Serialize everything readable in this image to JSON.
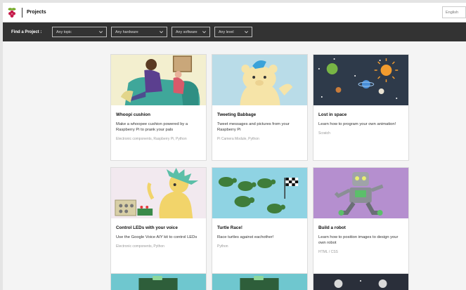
{
  "header": {
    "title": "Projects",
    "language": "English"
  },
  "filters": {
    "label": "Find a Project :",
    "topic": "Any topic",
    "hardware": "Any hardware",
    "software": "Any software",
    "level": "Any level"
  },
  "cards": [
    {
      "title": "Whoopi cushion",
      "description": "Make a whoopee cushion powered by a Raspberry Pi to prank your pals",
      "tags": "Electronic components, Raspberry Pi, Python"
    },
    {
      "title": "Tweeting Babbage",
      "description": "Tweet messages and pictures from your Raspberry Pi",
      "tags": "Pi Camera Module, Python"
    },
    {
      "title": "Lost in space",
      "description": "Learn how to program your own animation!",
      "tags": "Scratch"
    },
    {
      "title": "Control LEDs with your voice",
      "description": "Use the Google Voice AIY kit to control LEDs",
      "tags": "Electronic components, Python"
    },
    {
      "title": "Turtle Race!",
      "description": "Race turtles against eachother!",
      "tags": "Python"
    },
    {
      "title": "Build a robot",
      "description": "Learn how to position images to design your own robot",
      "tags": "HTML / CSS"
    }
  ],
  "colors": {
    "filterbar": "#333333",
    "accent_raspberry": "#c51a4a",
    "leaf": "#75a928"
  }
}
